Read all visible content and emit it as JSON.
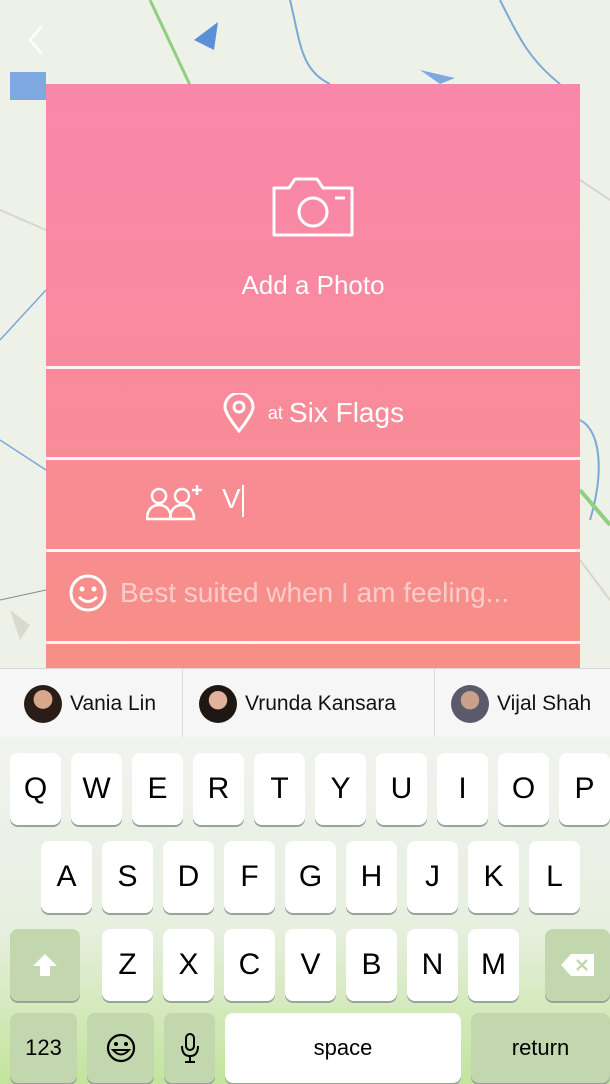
{
  "header": {
    "back_icon": "chevron-left-icon"
  },
  "card": {
    "photo_label": "Add a Photo",
    "camera_icon": "camera-icon",
    "location": {
      "prefix": "at",
      "place": "Six Flags",
      "icon": "location-pin-icon"
    },
    "tag_friends": {
      "icon": "add-friends-icon",
      "value": "V"
    },
    "mood": {
      "icon": "smiley-icon",
      "placeholder": "Best suited when I am feeling..."
    }
  },
  "suggestions": [
    {
      "name": "Vania Lin"
    },
    {
      "name": "Vrunda Kansara"
    },
    {
      "name": "Vijal Shah"
    }
  ],
  "keyboard": {
    "row1": [
      "Q",
      "W",
      "E",
      "R",
      "T",
      "Y",
      "U",
      "I",
      "O",
      "P"
    ],
    "row2": [
      "A",
      "S",
      "D",
      "F",
      "G",
      "H",
      "J",
      "K",
      "L"
    ],
    "row3": [
      "Z",
      "X",
      "C",
      "V",
      "B",
      "N",
      "M"
    ],
    "numbers_label": "123",
    "space_label": "space",
    "return_label": "return"
  },
  "colors": {
    "card_top": "#f987ab",
    "card_bottom": "#f78f84",
    "keyboard_accent": "#c2d7ad"
  }
}
